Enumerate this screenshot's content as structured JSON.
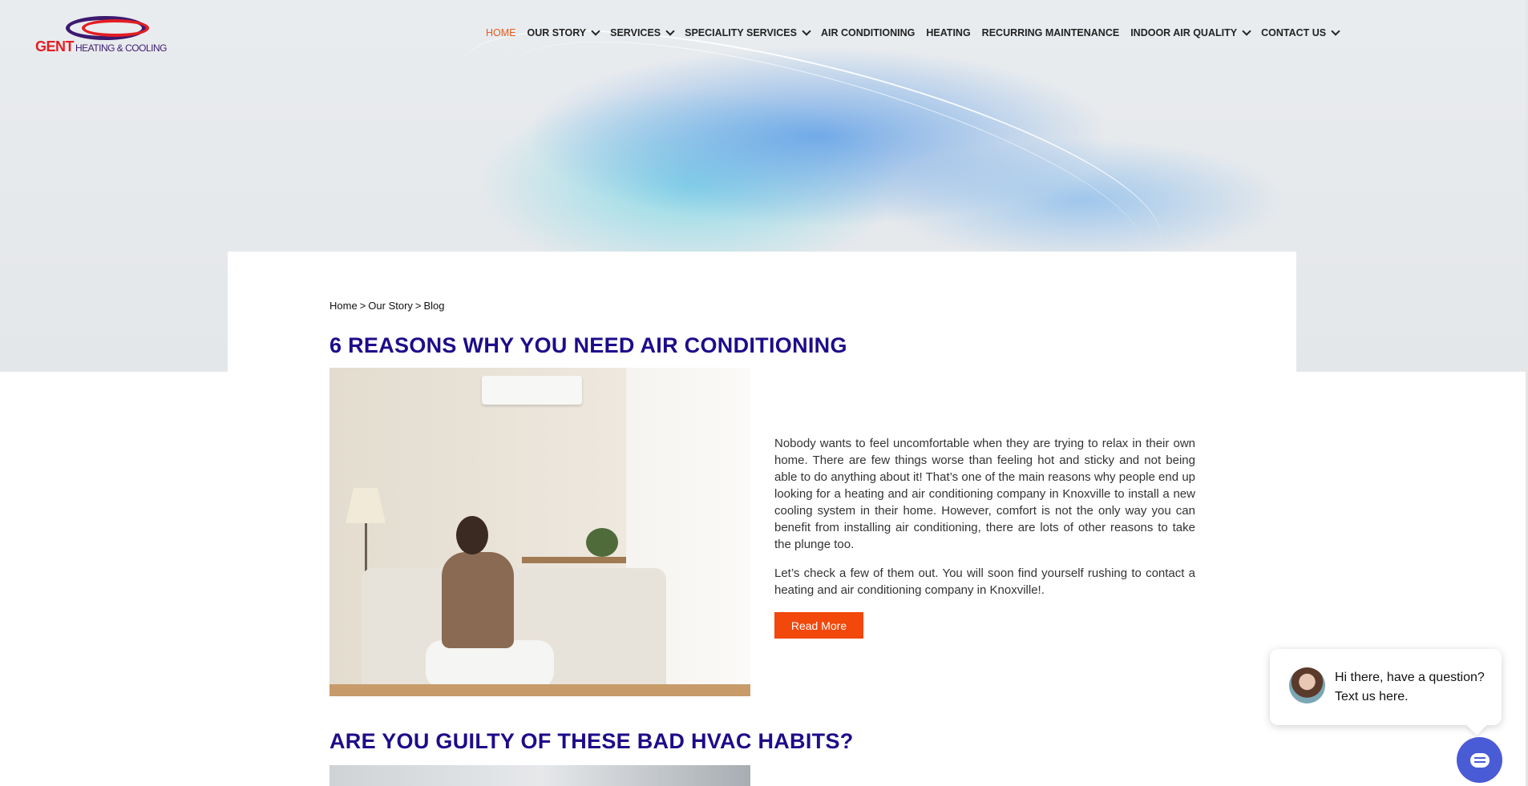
{
  "brand": {
    "logo_word": "GENT",
    "logo_sub": "HEATING & COOLING",
    "colors": {
      "red": "#e31e24",
      "purple": "#3b1a6e",
      "accent": "#f2480c",
      "title": "#1d0c8a"
    }
  },
  "nav": {
    "items": [
      {
        "label": "HOME",
        "active": true,
        "dropdown": false
      },
      {
        "label": "OUR STORY",
        "active": false,
        "dropdown": true
      },
      {
        "label": "SERVICES",
        "active": false,
        "dropdown": true
      },
      {
        "label": "SPECIALITY SERVICES",
        "active": false,
        "dropdown": true
      },
      {
        "label": "AIR CONDITIONING",
        "active": false,
        "dropdown": false
      },
      {
        "label": "HEATING",
        "active": false,
        "dropdown": false
      },
      {
        "label": "RECURRING MAINTENANCE",
        "active": false,
        "dropdown": false
      },
      {
        "label": "INDOOR AIR QUALITY",
        "active": false,
        "dropdown": true
      },
      {
        "label": "CONTACT US",
        "active": false,
        "dropdown": true
      }
    ]
  },
  "breadcrumb": {
    "items": [
      "Home",
      "Our Story",
      "Blog"
    ],
    "separator": ">"
  },
  "posts": [
    {
      "title": "6 REASONS WHY YOU NEED AIR CONDITIONING",
      "paragraphs": [
        "Nobody wants to feel uncomfortable when they are trying to relax in their own home. There are few things worse than feeling hot and sticky and not being able to do anything about it! That’s one of the main reasons why people end up looking for a heating and air conditioning company in Knoxville to install a new cooling system in their home. However, comfort is not the only way you can benefit from installing air conditioning, there are lots of other reasons to take the plunge too.",
        "Let’s check a few of them out. You will soon find yourself rushing to contact a heating and air conditioning company in Knoxville!."
      ],
      "button": "Read More"
    },
    {
      "title": "ARE YOU GUILTY OF THESE BAD HVAC HABITS?"
    }
  ],
  "chat": {
    "message": "Hi there, have a question? Text us here.",
    "launcher_icon": "chat-icon"
  }
}
